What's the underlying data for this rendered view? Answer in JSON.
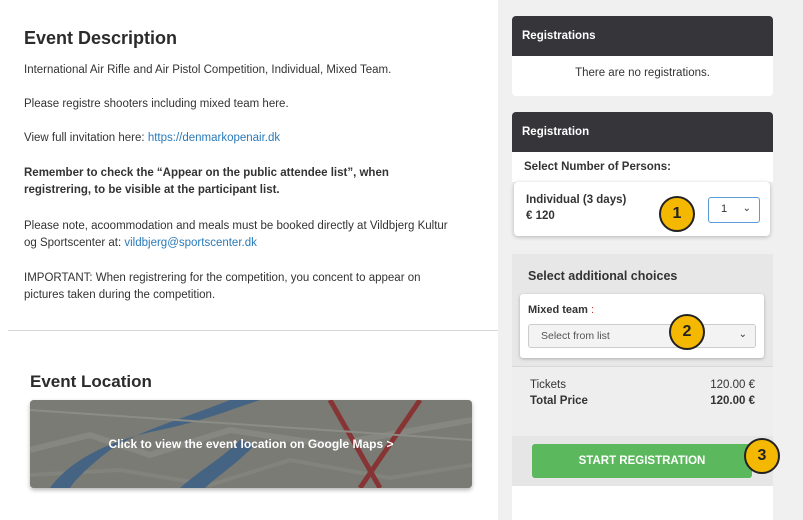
{
  "description": {
    "title": "Event Description",
    "line1": "International Air Rifle and Air Pistol Competition, Individual, Mixed Team.",
    "line2": "Please registre shooters including mixed team here.",
    "invite_prefix": "View full invitation here: ",
    "invite_link": "https://denmarkopenair.dk",
    "remember_1": "Remember to check the “Appear on the public attendee list”, when",
    "remember_2": "registrering, to be visible at the participant list.",
    "note_1": "Please note, acoommodation and meals must be booked directly at Vildbjerg Kultur",
    "note_2_prefix": "og Sportscenter at: ",
    "note_email": "vildbjerg@sportscenter.dk",
    "important_1": "IMPORTANT: When registrering for the competition, you concent to appear on",
    "important_2": "pictures taken during the competition."
  },
  "location": {
    "title": "Event Location",
    "map_cta": "Click to view the event location on Google Maps >"
  },
  "registrations": {
    "header": "Registrations",
    "empty_text": "There are no registrations."
  },
  "registration": {
    "header": "Registration",
    "select_persons_label": "Select Number of Persons:",
    "ticket_name": "Individual (3 days)",
    "ticket_price": "€ 120",
    "quantity": "1",
    "additional_title": "Select additional choices",
    "mixed_team_label": "Mixed team",
    "mixed_team_colon": ":",
    "mixed_team_placeholder": "Select from list",
    "tickets_label": "Tickets",
    "tickets_value": "120.00 €",
    "total_label": "Total Price",
    "total_value": "120.00 €",
    "start_button": "START REGISTRATION"
  },
  "markers": [
    "1",
    "2",
    "3"
  ],
  "colors": {
    "panel_header": "#363539",
    "cta": "#5cb85c",
    "link": "#2a7ab9",
    "marker": "#f5b800"
  }
}
